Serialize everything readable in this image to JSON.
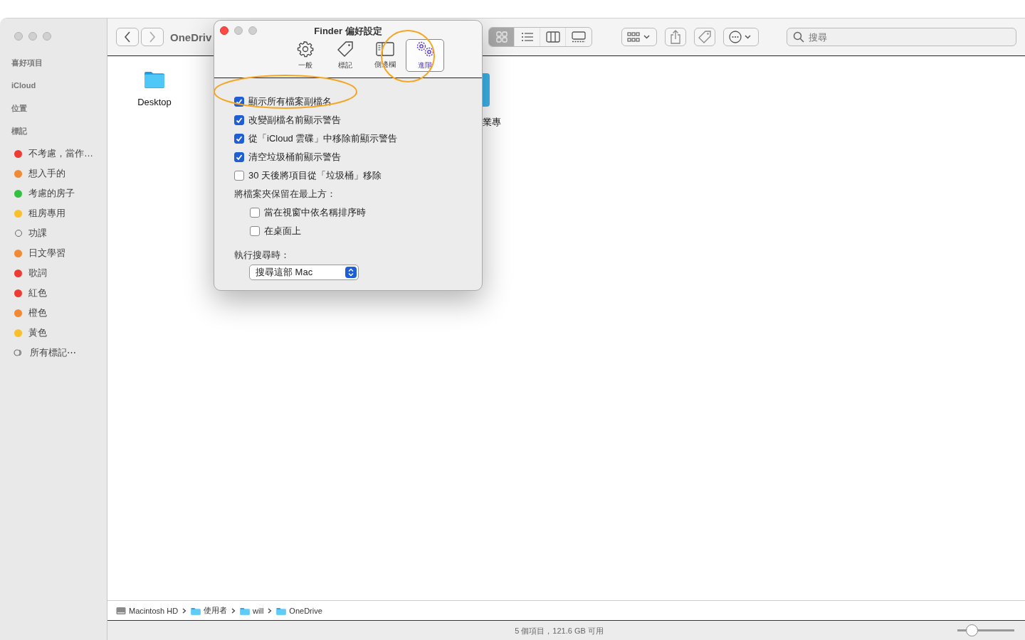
{
  "sidebar": {
    "sections": [
      {
        "title": "喜好項目"
      },
      {
        "title": "iCloud"
      },
      {
        "title": "位置"
      },
      {
        "title": "標記",
        "items": [
          {
            "kind": "dot",
            "label": "不考慮，當作…",
            "color": "#ec3c35"
          },
          {
            "kind": "dot",
            "label": "想入手的",
            "color": "#f08a36"
          },
          {
            "kind": "dot",
            "label": "考慮的房子",
            "color": "#35c043"
          },
          {
            "kind": "dot",
            "label": "租房專用",
            "color": "#f8c02f"
          },
          {
            "kind": "hollow",
            "label": "功課"
          },
          {
            "kind": "dot",
            "label": "日文學習",
            "color": "#f08a36"
          },
          {
            "kind": "dot",
            "label": "歌詞",
            "color": "#ec3c35"
          },
          {
            "kind": "dot",
            "label": "紅色",
            "color": "#ec3c35"
          },
          {
            "kind": "dot",
            "label": "橙色",
            "color": "#f08a36"
          },
          {
            "kind": "dot",
            "label": "黃色",
            "color": "#f8c02f"
          },
          {
            "kind": "all",
            "label": "所有標記⋯"
          }
        ]
      }
    ]
  },
  "toolbar": {
    "title": "OneDriv",
    "view_modes": [
      {
        "kind": "icons",
        "selected": true
      },
      {
        "kind": "list",
        "selected": false
      },
      {
        "kind": "columns",
        "selected": false
      },
      {
        "kind": "gallery",
        "selected": false
      }
    ],
    "search": {
      "placeholder": "搜尋"
    }
  },
  "content": {
    "items": [
      {
        "kind": "folder",
        "label": "Desktop"
      },
      {
        "kind": "partial",
        "label": "業專"
      }
    ]
  },
  "path_bar": [
    {
      "kind": "disk",
      "label": "Macintosh HD"
    },
    {
      "kind": "folder",
      "label": "使用者"
    },
    {
      "kind": "folder",
      "label": "will"
    },
    {
      "kind": "folder",
      "label": "OneDrive"
    }
  ],
  "status_bar": {
    "text": "5 個項目，121.6 GB 可用",
    "zoom": {
      "level": 0.25
    }
  },
  "dialog": {
    "title": "Finder 偏好設定",
    "tabs": [
      {
        "kind": "gear",
        "label": "一般",
        "selected": false
      },
      {
        "kind": "tag",
        "label": "標記",
        "selected": false
      },
      {
        "kind": "sidebar",
        "label": "側邊欄",
        "selected": false
      },
      {
        "kind": "gears",
        "label": "進階",
        "selected": true
      }
    ],
    "options": [
      {
        "kind": "checkbox",
        "label": "顯示所有檔案副檔名",
        "checked": true
      },
      {
        "kind": "checkbox",
        "label": "改變副檔名前顯示警告",
        "checked": true
      },
      {
        "kind": "checkbox",
        "label": "從「iCloud 雲碟」中移除前顯示警告",
        "checked": true
      },
      {
        "kind": "checkbox",
        "label": "清空垃圾桶前顯示警告",
        "checked": true
      },
      {
        "kind": "checkbox",
        "label": "30 天後將項目從「垃圾桶」移除",
        "checked": false
      },
      {
        "kind": "heading",
        "label": "將檔案夾保留在最上方：",
        "children": [
          {
            "kind": "checkbox",
            "label": "當在視窗中依名稱排序時",
            "checked": false
          },
          {
            "kind": "checkbox",
            "label": "在桌面上",
            "checked": false
          }
        ]
      }
    ],
    "search_scope": {
      "label": "執行搜尋時：",
      "value": "搜尋這部 Mac"
    }
  }
}
